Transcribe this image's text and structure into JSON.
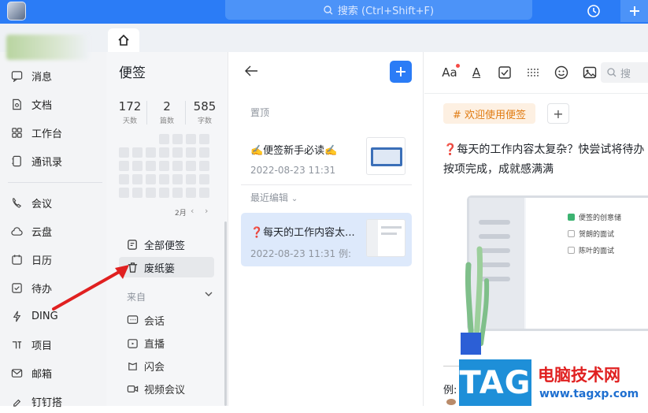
{
  "topbar": {
    "search_placeholder": "搜索 (Ctrl+Shift+F)"
  },
  "nav": {
    "items": [
      {
        "label": "消息",
        "icon": "message-icon"
      },
      {
        "label": "文档",
        "icon": "document-icon"
      },
      {
        "label": "工作台",
        "icon": "workbench-icon"
      },
      {
        "label": "通讯录",
        "icon": "contacts-icon"
      },
      {
        "label": "会议",
        "icon": "meeting-icon"
      },
      {
        "label": "云盘",
        "icon": "cloud-icon"
      },
      {
        "label": "日历",
        "icon": "calendar-icon"
      },
      {
        "label": "待办",
        "icon": "todo-icon"
      },
      {
        "label": "DING",
        "icon": "ding-icon"
      },
      {
        "label": "项目",
        "icon": "project-icon"
      },
      {
        "label": "邮箱",
        "icon": "mail-icon"
      },
      {
        "label": "钉钉搭",
        "icon": "build-icon"
      }
    ]
  },
  "panel": {
    "title": "便签",
    "stats": [
      {
        "value": "172",
        "label": "天数"
      },
      {
        "value": "2",
        "label": "篇数"
      },
      {
        "value": "585",
        "label": "字数"
      }
    ],
    "month": "2月",
    "categories": {
      "all": "全部便签",
      "trash": "废纸篓"
    },
    "from_label": "来自",
    "sources": [
      "会话",
      "直播",
      "闪会",
      "视频会议"
    ]
  },
  "list": {
    "pinned_label": "置顶",
    "recent_label": "最近编辑",
    "notes": [
      {
        "title": "✍️便签新手必读✍️",
        "meta": "2022-08-23 11:31"
      },
      {
        "title": "❓每天的工作内容太...",
        "meta": "2022-08-23 11:31  例:"
      }
    ]
  },
  "editor": {
    "toolbar": {
      "font_size": "Aa",
      "text_color": "A",
      "search": "搜"
    },
    "tag": "# 欢迎使用便签",
    "tag_add": "+",
    "line1": "❓每天的工作内容太复杂？快尝试将待办",
    "line2": "按项完成，成就感满满",
    "checklist": [
      "便签的创意储",
      "贺朗的面试",
      "陈叶的面试"
    ],
    "example": "例:"
  },
  "watermark": {
    "logo": "TAG",
    "title": "电脑技术网",
    "url": "www.tagxp.com"
  },
  "colors": {
    "accent": "#2b7cf6",
    "tag_bg": "#fdf0e2",
    "tag_fg": "#e07b12",
    "arrow": "#e02020"
  }
}
